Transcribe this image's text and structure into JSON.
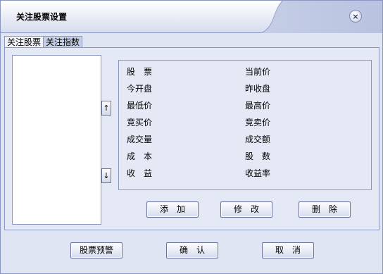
{
  "window": {
    "title": "关注股票设置",
    "close_symbol": "×"
  },
  "tabs": [
    {
      "label": "关注股票",
      "active": true
    },
    {
      "label": "关注指数",
      "active": false
    }
  ],
  "stock_list": {
    "items": []
  },
  "move_buttons": {
    "up": "↑",
    "down": "↓"
  },
  "fields": {
    "left": [
      "股　票",
      "今开盘",
      "最低价",
      "竞买价",
      "成交量",
      "成　本",
      "收　益"
    ],
    "right": [
      "当前价",
      "昨收盘",
      "最高价",
      "竞卖价",
      "成交额",
      "股　数",
      "收益率"
    ]
  },
  "actions": {
    "add": "添　加",
    "edit": "修　改",
    "delete": "删　除"
  },
  "footer": {
    "alert": "股票预警",
    "ok": "确　认",
    "cancel": "取　消"
  },
  "colors": {
    "title_bar_light": "#ffffff",
    "title_bar_dark": "#b9c3e0",
    "border": "#8a97c0",
    "background": "#e4e9f5"
  }
}
